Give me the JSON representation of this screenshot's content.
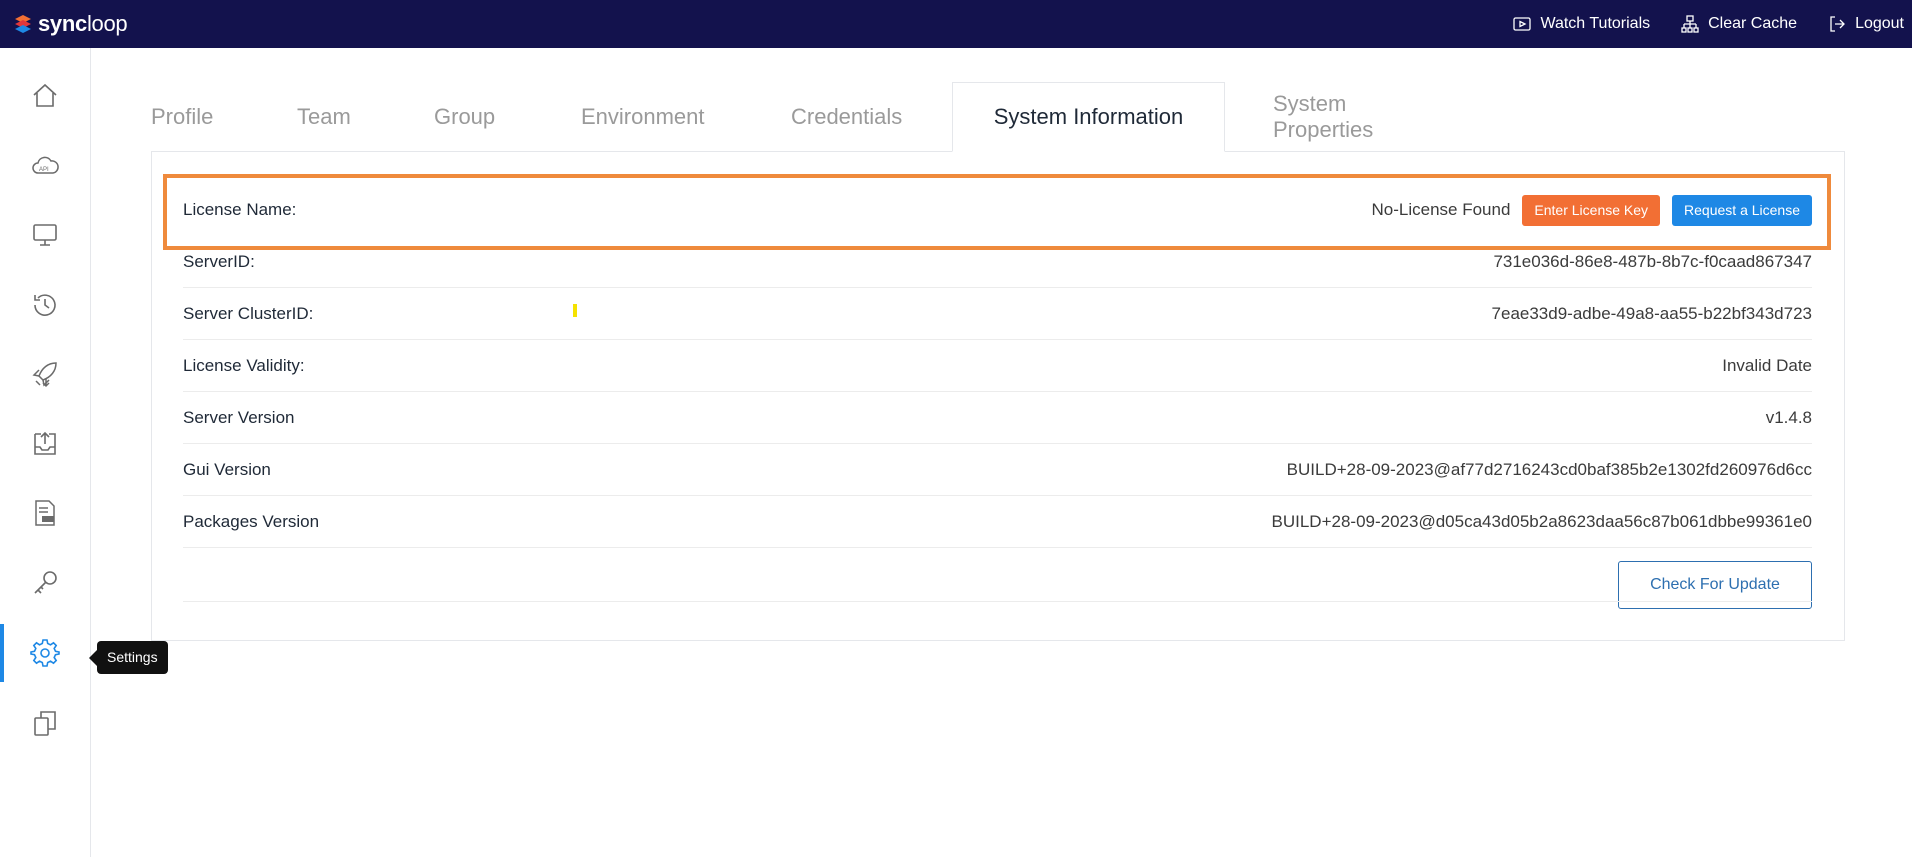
{
  "brand": {
    "name_bold": "sync",
    "name_rest": "loop"
  },
  "topbar": {
    "actions": [
      {
        "label": "Watch Tutorials",
        "icon": "play-icon"
      },
      {
        "label": "Clear Cache",
        "icon": "cache-icon"
      },
      {
        "label": "Logout",
        "icon": "logout-icon"
      }
    ]
  },
  "sidebar": {
    "items": [
      {
        "icon": "home-icon"
      },
      {
        "icon": "api-cloud-icon"
      },
      {
        "icon": "monitor-icon"
      },
      {
        "icon": "history-clock-icon"
      },
      {
        "icon": "deploy-rocket-icon"
      },
      {
        "icon": "inbox-upload-icon"
      },
      {
        "icon": "log-file-icon"
      },
      {
        "icon": "key-icon"
      },
      {
        "icon": "settings-gear-icon",
        "active": true
      },
      {
        "icon": "copy-icon"
      }
    ],
    "tooltip": "Settings"
  },
  "tabs": [
    {
      "label": "Profile"
    },
    {
      "label": "Team"
    },
    {
      "label": "Group"
    },
    {
      "label": "Environment"
    },
    {
      "label": "Credentials"
    },
    {
      "label": "System Information",
      "active": true
    },
    {
      "label": "System Properties"
    }
  ],
  "license": {
    "label": "License Name:",
    "status": "No-License Found",
    "enter_key_label": "Enter License Key",
    "request_label": "Request a License"
  },
  "rows": [
    {
      "label": "ServerID:",
      "value": "731e036d-86e8-487b-8b7c-f0caad867347"
    },
    {
      "label": "Server ClusterID:",
      "value": "7eae33d9-adbe-49a8-aa55-b22bf343d723"
    },
    {
      "label": "License Validity:",
      "value": "Invalid Date"
    },
    {
      "label": "Server Version",
      "value": "v1.4.8"
    },
    {
      "label": "Gui Version",
      "value": "BUILD+28-09-2023@af77d2716243cd0baf385b2e1302fd260976d6cc"
    },
    {
      "label": "Packages Version",
      "value": "BUILD+28-09-2023@d05ca43d05b2a8623daa56c87b061dbbe99361e0"
    }
  ],
  "check_update_label": "Check For Update",
  "colors": {
    "topbar_bg": "#13124d",
    "accent_blue": "#1e88e5",
    "accent_orange": "#f26f34",
    "highlight_border": "#ef8a3c"
  }
}
